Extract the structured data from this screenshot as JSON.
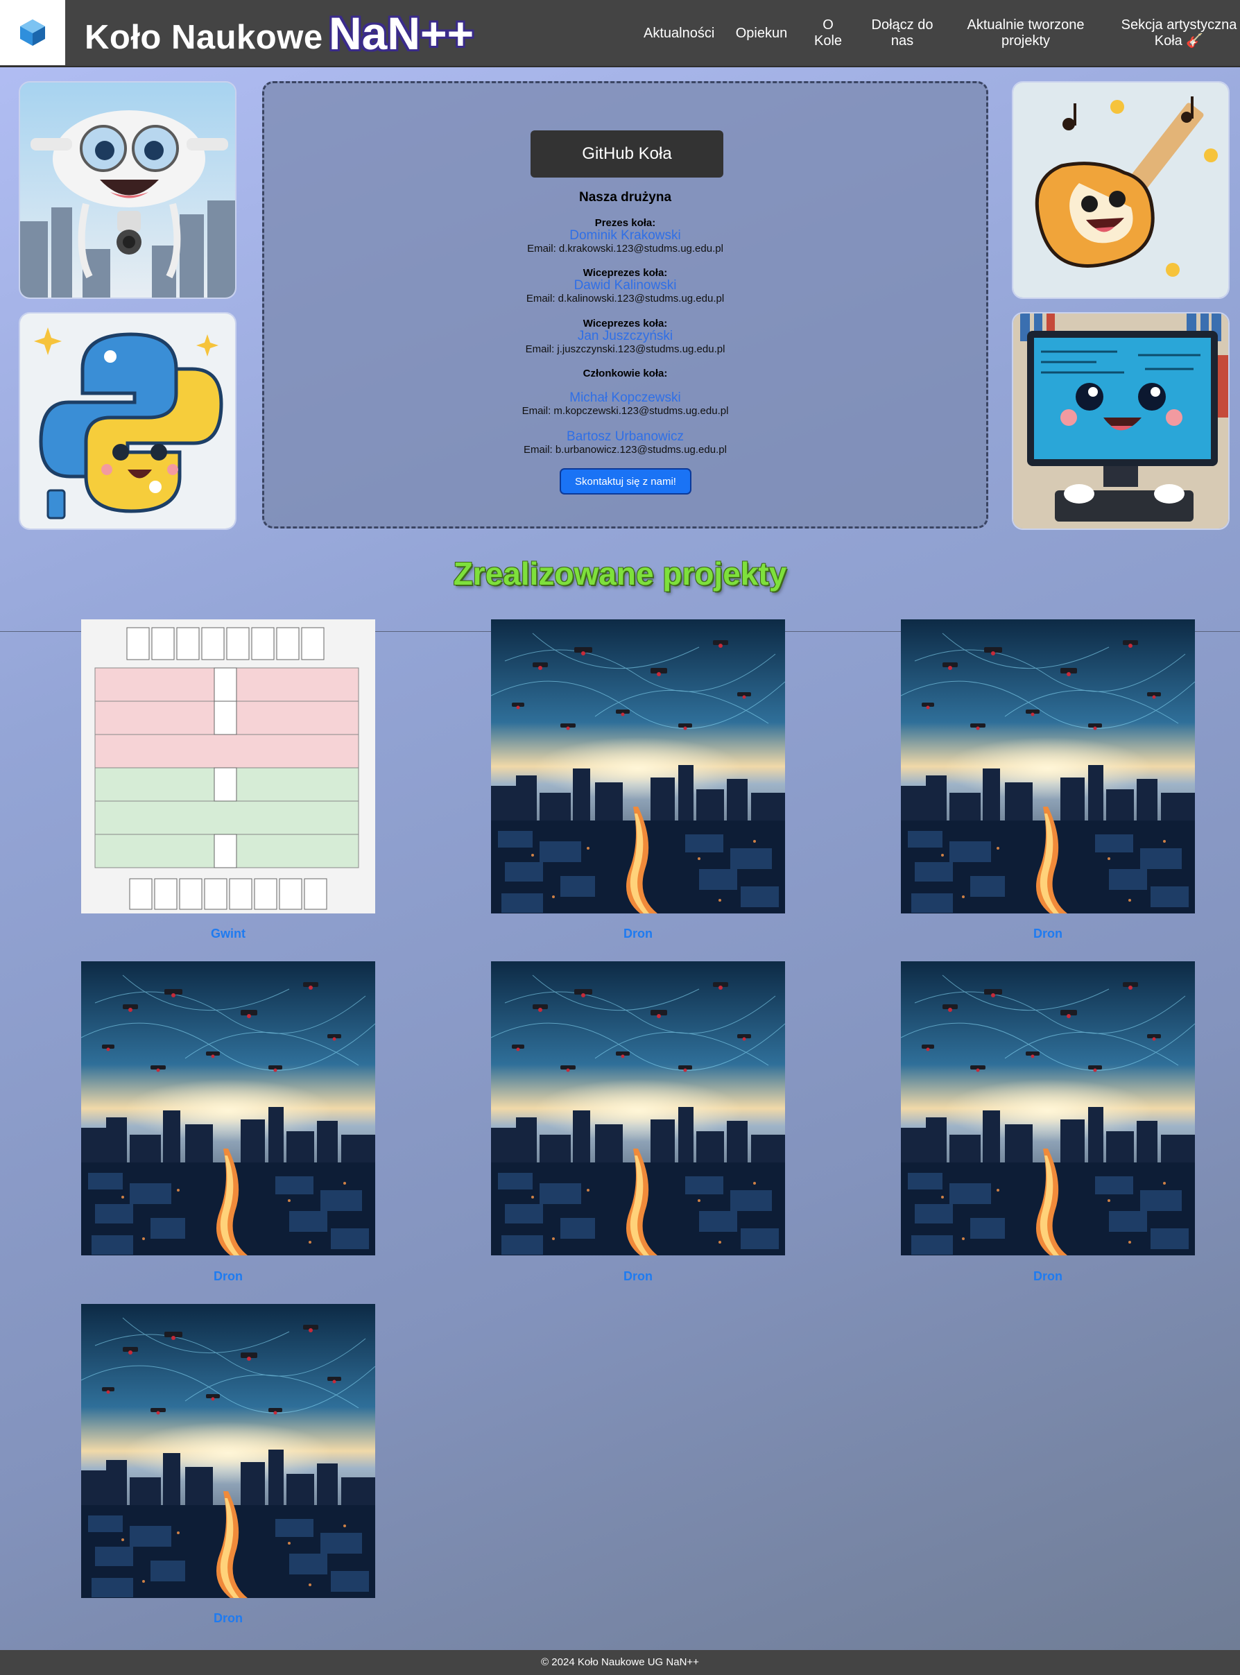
{
  "header": {
    "brand_name": "Koło Naukowe",
    "brand_tag": "NaN++",
    "nav": [
      {
        "label": "Aktualności"
      },
      {
        "label": "Opiekun"
      },
      {
        "label": "O\nKole"
      },
      {
        "label": "Dołącz do\nnas"
      },
      {
        "label": "Aktualnie tworzone\nprojekty"
      },
      {
        "label": "Sekcja artystyczna\nKoła 🎸"
      }
    ]
  },
  "side_images": [
    {
      "icon": "drone-robot-illustration"
    },
    {
      "icon": "python-mascot-illustration"
    },
    {
      "icon": "guitar-mascot-illustration"
    },
    {
      "icon": "computer-mascot-illustration"
    }
  ],
  "team": {
    "github_label": "GitHub Koła",
    "title": "Nasza drużyna",
    "members_heading": "Członkowie koła:",
    "leaders": [
      {
        "role": "Prezes koła:",
        "name": "Dominik Krakowski",
        "email": "Email: d.krakowski.123@studms.ug.edu.pl"
      },
      {
        "role": "Wiceprezes koła:",
        "name": "Dawid Kalinowski",
        "email": "Email: d.kalinowski.123@studms.ug.edu.pl"
      },
      {
        "role": "Wiceprezes koła:",
        "name": "Jan Juszczyński",
        "email": "Email: j.juszczynski.123@studms.ug.edu.pl"
      }
    ],
    "members": [
      {
        "name": "Michał Kopczewski",
        "email": "Email: m.kopczewski.123@studms.ug.edu.pl"
      },
      {
        "name": "Bartosz Urbanowicz",
        "email": "Email: b.urbanowicz.123@studms.ug.edu.pl"
      }
    ],
    "contact_label": "Skontaktuj się z nami!"
  },
  "projects": {
    "title": "Zrealizowane projekty",
    "items": [
      {
        "label": "Gwint",
        "image": "board-game-screenshot"
      },
      {
        "label": "Dron",
        "image": "drones-over-city"
      },
      {
        "label": "Dron",
        "image": "drones-over-city"
      },
      {
        "label": "Dron",
        "image": "drones-over-city"
      },
      {
        "label": "Dron",
        "image": "drones-over-city"
      },
      {
        "label": "Dron",
        "image": "drones-over-city"
      },
      {
        "label": "Dron",
        "image": "drones-over-city"
      }
    ]
  },
  "colors": {
    "link": "#2f6fe6",
    "accent_title": "#7ee03c",
    "header_bg": "#444444"
  },
  "footer": {
    "text": "© 2024 Koło Naukowe UG NaN++"
  }
}
